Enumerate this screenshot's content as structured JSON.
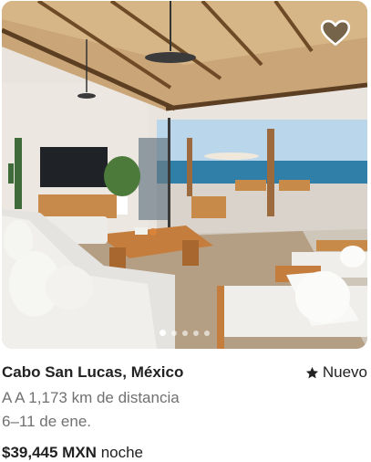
{
  "listing": {
    "title": "Cabo San Lucas, México",
    "rating_label": "Nuevo",
    "distance": "A A 1,173 km de distancia",
    "dates": "6–11 de ene.",
    "price": "$39,445 MXN",
    "price_unit": "noche"
  },
  "carousel": {
    "slides_total": 5,
    "active_slide": 1
  },
  "colors": {
    "primary_text": "#222222",
    "secondary_text": "#717171",
    "heart_outline": "#ffffff"
  },
  "icons": {
    "favorite": "heart-icon",
    "rating": "star-icon"
  }
}
